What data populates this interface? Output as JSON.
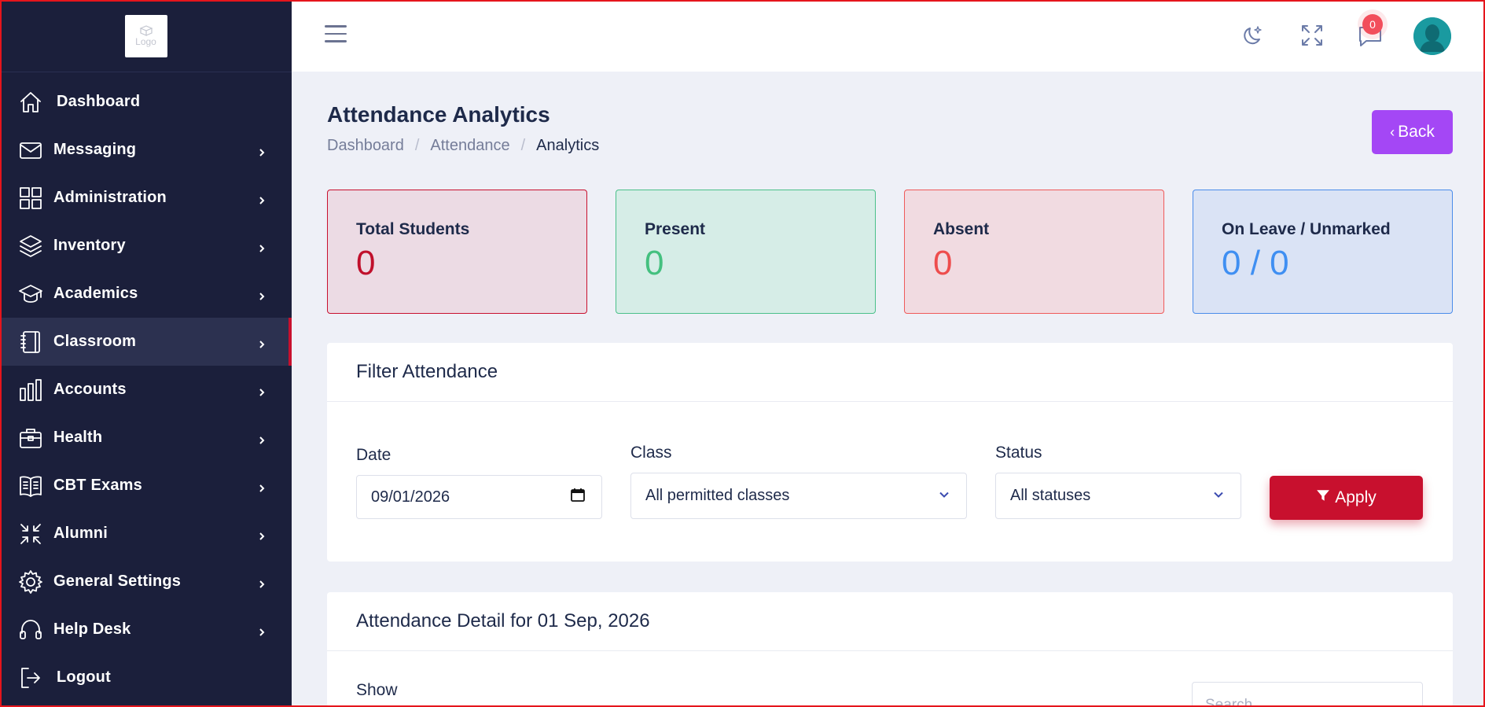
{
  "logo": {
    "text": "Logo"
  },
  "sidebar": {
    "items": [
      {
        "label": "Dashboard",
        "icon": "home-icon",
        "has_chevron": false
      },
      {
        "label": "Messaging",
        "icon": "mail-icon",
        "has_chevron": true
      },
      {
        "label": "Administration",
        "icon": "grid-icon",
        "has_chevron": true
      },
      {
        "label": "Inventory",
        "icon": "layers-icon",
        "has_chevron": true
      },
      {
        "label": "Academics",
        "icon": "graduation-cap-icon",
        "has_chevron": true
      },
      {
        "label": "Classroom",
        "icon": "notebook-icon",
        "has_chevron": true,
        "active": true
      },
      {
        "label": "Accounts",
        "icon": "bar-chart-icon",
        "has_chevron": true
      },
      {
        "label": "Health",
        "icon": "briefcase-icon",
        "has_chevron": true
      },
      {
        "label": "CBT Exams",
        "icon": "book-icon",
        "has_chevron": true
      },
      {
        "label": "Alumni",
        "icon": "minimize-icon",
        "has_chevron": true
      },
      {
        "label": "General Settings",
        "icon": "gear-icon",
        "has_chevron": true
      },
      {
        "label": "Help Desk",
        "icon": "headphones-icon",
        "has_chevron": true
      },
      {
        "label": "Logout",
        "icon": "logout-icon",
        "has_chevron": false
      }
    ]
  },
  "topbar": {
    "icons": [
      "hamburger-menu-icon",
      "moon-stars-icon",
      "fullscreen-icon",
      "chat-icon"
    ],
    "notification_count": "0"
  },
  "page": {
    "title": "Attendance Analytics",
    "breadcrumb": [
      "Dashboard",
      "Attendance",
      "Analytics"
    ],
    "back_button": "Back"
  },
  "stats": {
    "total": {
      "label": "Total Students",
      "value": "0"
    },
    "present": {
      "label": "Present",
      "value": "0"
    },
    "absent": {
      "label": "Absent",
      "value": "0"
    },
    "leave": {
      "label": "On Leave / Unmarked",
      "value": "0 / 0"
    }
  },
  "filter": {
    "title": "Filter Attendance",
    "date_label": "Date",
    "date_value": "09/01/2026",
    "class_label": "Class",
    "class_value": "All permitted classes",
    "status_label": "Status",
    "status_value": "All statuses",
    "apply_button": "Apply"
  },
  "detail": {
    "title": "Attendance Detail for 01 Sep, 2026",
    "show_label": "Show",
    "search_placeholder": "Search..."
  },
  "colors": {
    "sidebar_bg": "#1b1f3b",
    "accent_red": "#c8102e",
    "back_purple": "#a447f5",
    "present_green": "#44c07f",
    "absent_red": "#ee4d4d",
    "leave_blue": "#3f8ff2"
  }
}
